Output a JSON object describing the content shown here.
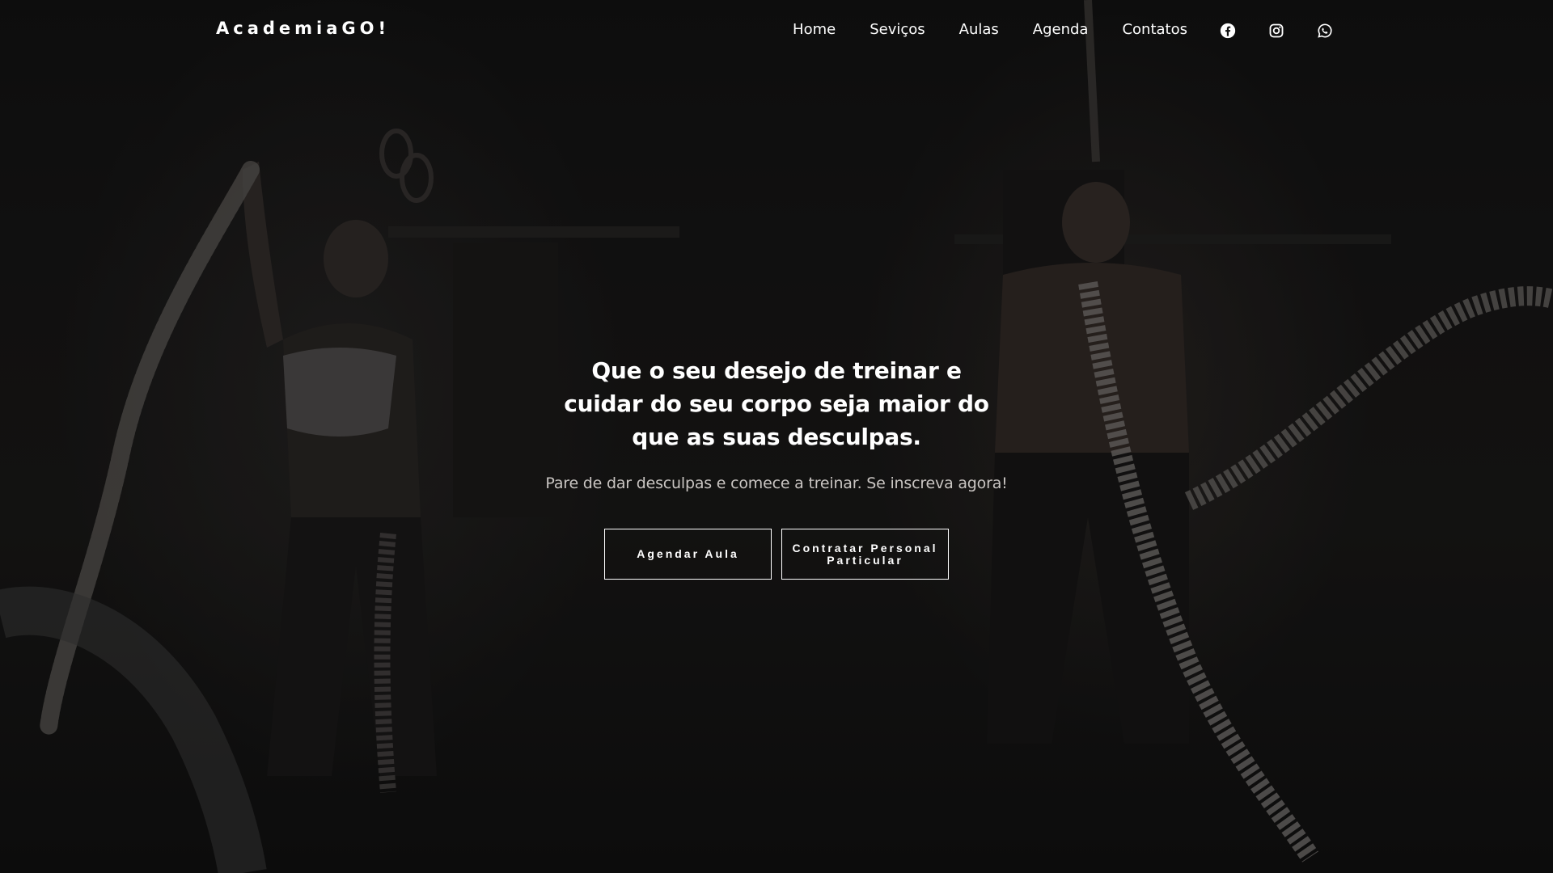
{
  "navbar": {
    "brand": "AcademiaGO!",
    "links": [
      "Home",
      "Seviços",
      "Aulas",
      "Agenda",
      "Contatos"
    ],
    "social_icons": [
      "facebook-icon",
      "instagram-icon",
      "whatsapp-icon"
    ]
  },
  "hero": {
    "title": "Que o seu desejo de treinar e cuidar do seu corpo seja maior do que as suas desculpas.",
    "subtitle": "Pare de dar desculpas e comece a treinar. Se inscreva agora!",
    "buttons": {
      "primary": "Agendar Aula",
      "secondary": "Contratar Personal Particular"
    }
  },
  "colors": {
    "background": "#111111",
    "text": "#ffffff",
    "subtitle": "#c9c5c2"
  }
}
